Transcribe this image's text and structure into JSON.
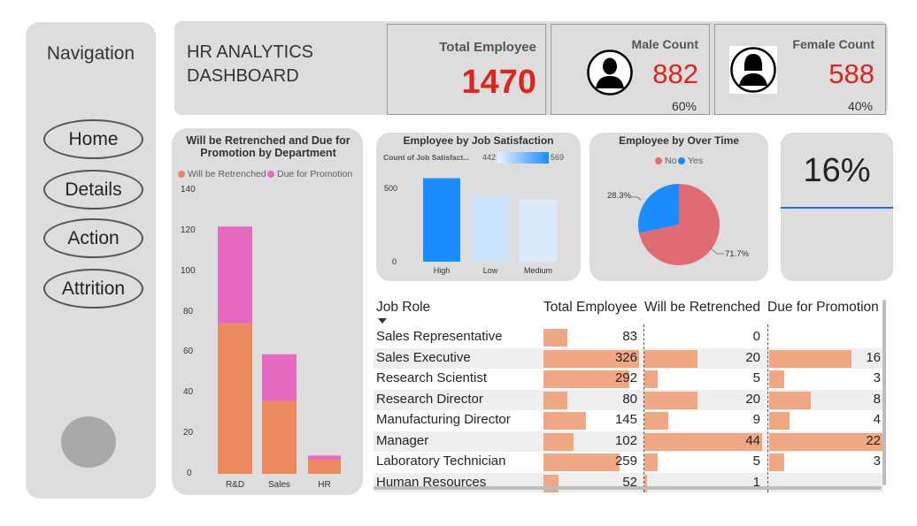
{
  "navigation": {
    "title": "Navigation",
    "items": [
      {
        "label": "Home"
      },
      {
        "label": "Details"
      },
      {
        "label": "Action"
      },
      {
        "label": "Attrition"
      }
    ]
  },
  "header": {
    "title": "HR ANALYTICS DASHBOARD",
    "total": {
      "label": "Total Employee",
      "value": "1470"
    },
    "male": {
      "label": "Male Count",
      "value": "882",
      "pct": "60%"
    },
    "female": {
      "label": "Female Count",
      "value": "588",
      "pct": "40%"
    }
  },
  "colors": {
    "retrenched": "#eb895f",
    "promotion": "#e66ac0",
    "accent_red": "#e0231c",
    "no": "#e06b72",
    "yes": "#1a8cff",
    "table_bar": "#f0a884"
  },
  "retrench_chart": {
    "title": "Will be Retrenched and Due for Promotion by Department",
    "legend": [
      "Will be Retrenched",
      "Due for Promotion"
    ],
    "y_ticks": [
      "140",
      "120",
      "100",
      "80",
      "60",
      "40",
      "20",
      "0"
    ]
  },
  "jobsat_chart": {
    "title": "Employee by Job Satisfaction",
    "scale_label": "Count of Job Satisfact...",
    "scale_min": "442",
    "scale_max": "569",
    "y_ticks": [
      "500",
      "0"
    ]
  },
  "overtime_chart": {
    "title": "Employee by Over Time",
    "legend": [
      "No",
      "Yes"
    ],
    "label_yes": "28.3%",
    "label_no": "71.7%"
  },
  "kpi": {
    "value": "16%"
  },
  "chart_data": [
    {
      "type": "bar",
      "stacked": true,
      "title": "Will be Retrenched and Due for Promotion by Department",
      "categories": [
        "R&D",
        "Sales",
        "HR"
      ],
      "series": [
        {
          "name": "Will be Retrenched",
          "values": [
            74,
            36,
            7
          ]
        },
        {
          "name": "Due for Promotion",
          "values": [
            48,
            23,
            2
          ]
        }
      ],
      "ylim": [
        0,
        140
      ],
      "legend": "top-left"
    },
    {
      "type": "bar",
      "title": "Employee by Job Satisfaction",
      "categories": [
        "High",
        "Low",
        "Medium"
      ],
      "values": [
        569,
        442,
        426
      ],
      "ylim": [
        0,
        600
      ],
      "color_scale": [
        "#cfe6ff",
        "#1a8cff"
      ]
    },
    {
      "type": "pie",
      "title": "Employee by Over Time",
      "categories": [
        "No",
        "Yes"
      ],
      "values": [
        71.7,
        28.3
      ],
      "legend": "top-center"
    }
  ],
  "table": {
    "columns": [
      "Job Role",
      "Total Employee",
      "Will be Retrenched",
      "Due for Promotion"
    ],
    "rows": [
      {
        "role": "Sales Representative",
        "total": 83,
        "retrenched": 0,
        "promotion": null
      },
      {
        "role": "Sales Executive",
        "total": 326,
        "retrenched": 20,
        "promotion": 16
      },
      {
        "role": "Research Scientist",
        "total": 292,
        "retrenched": 5,
        "promotion": 3
      },
      {
        "role": "Research Director",
        "total": 80,
        "retrenched": 20,
        "promotion": 8
      },
      {
        "role": "Manufacturing Director",
        "total": 145,
        "retrenched": 9,
        "promotion": 4
      },
      {
        "role": "Manager",
        "total": 102,
        "retrenched": 44,
        "promotion": 22
      },
      {
        "role": "Laboratory Technician",
        "total": 259,
        "retrenched": 5,
        "promotion": 3
      },
      {
        "role": "Human Resources",
        "total": 52,
        "retrenched": 1,
        "promotion": null
      }
    ]
  }
}
